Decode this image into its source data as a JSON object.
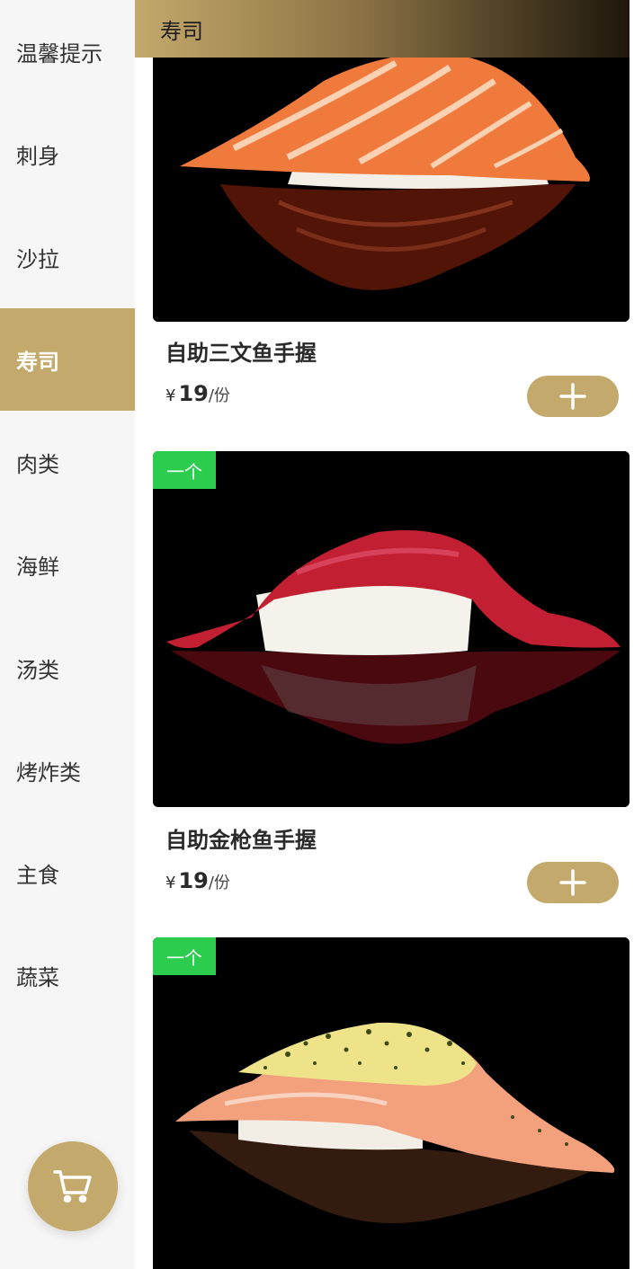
{
  "sidebar": {
    "items": [
      {
        "label": "温馨提示",
        "active": false
      },
      {
        "label": "刺身",
        "active": false
      },
      {
        "label": "沙拉",
        "active": false
      },
      {
        "label": "寿司",
        "active": true
      },
      {
        "label": "肉类",
        "active": false
      },
      {
        "label": "海鲜",
        "active": false
      },
      {
        "label": "汤类",
        "active": false
      },
      {
        "label": "烤炸类",
        "active": false
      },
      {
        "label": "主食",
        "active": false
      },
      {
        "label": "蔬菜",
        "active": false
      }
    ],
    "cart_icon": "cart-icon"
  },
  "section": {
    "title": "寿司"
  },
  "products": [
    {
      "name": "自助三文鱼手握",
      "currency": "¥",
      "price": "19",
      "unit": "/份",
      "badge": "",
      "image": "salmon-nigiri"
    },
    {
      "name": "自助金枪鱼手握",
      "currency": "¥",
      "price": "19",
      "unit": "/份",
      "badge": "一个",
      "image": "tuna-nigiri"
    },
    {
      "name": "",
      "currency": "",
      "price": "",
      "unit": "",
      "badge": "一个",
      "image": "seared-salmon-nigiri"
    }
  ],
  "colors": {
    "accent": "#c3a96b",
    "badge": "#2ccc4f",
    "sidebar_bg": "#f6f6f6"
  },
  "icons": {
    "add": "plus-icon",
    "cart": "cart-icon"
  }
}
